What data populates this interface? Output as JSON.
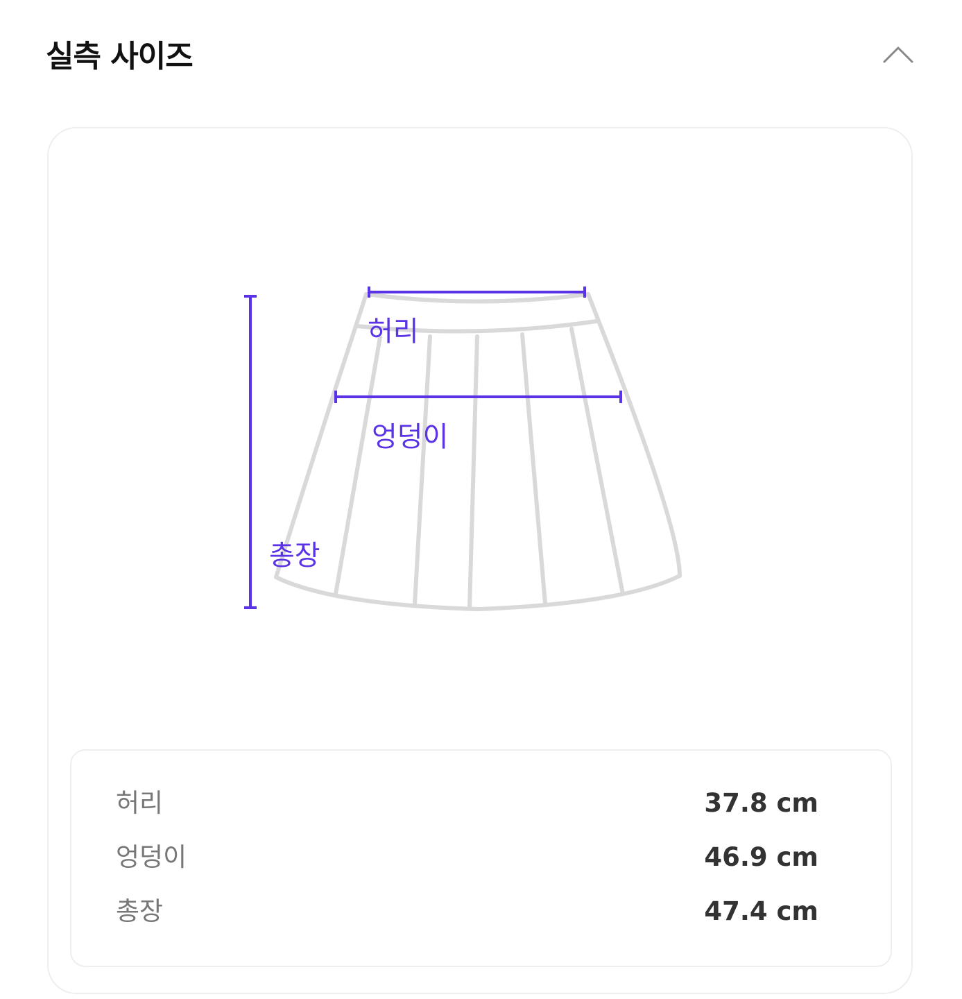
{
  "header": {
    "title": "실측 사이즈",
    "collapse_icon": "chevron-up-icon"
  },
  "diagram": {
    "labels": {
      "waist": "허리",
      "hip": "엉덩이",
      "length": "총장"
    },
    "accent_color": "#5b33e6",
    "outline_color": "#d9d9d9"
  },
  "measurements": [
    {
      "label": "허리",
      "value": "37.8 cm"
    },
    {
      "label": "엉덩이",
      "value": "46.9 cm"
    },
    {
      "label": "총장",
      "value": "47.4 cm"
    }
  ]
}
